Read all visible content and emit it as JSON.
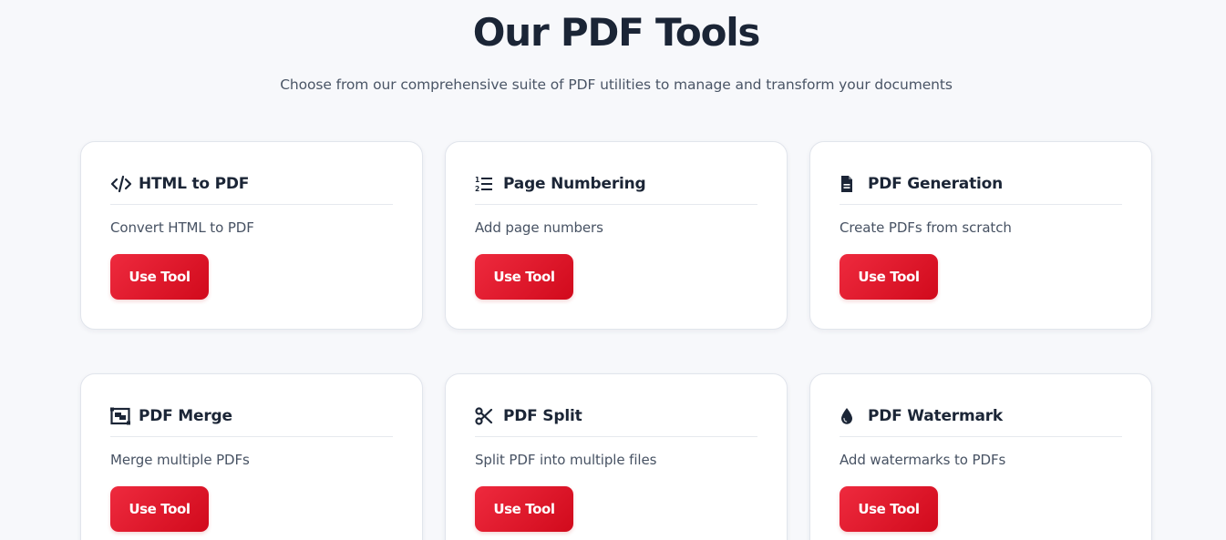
{
  "header": {
    "title": "Our PDF Tools",
    "subtitle": "Choose from our comprehensive suite of PDF utilities to manage and transform your documents"
  },
  "colors": {
    "accent": "#e01a2e",
    "background": "#f7f8fb",
    "heading": "#1b2536"
  },
  "tools": [
    {
      "icon": "code-icon",
      "title": "HTML to PDF",
      "description": "Convert HTML to PDF",
      "button": "Use Tool"
    },
    {
      "icon": "numbered-list-icon",
      "title": "Page Numbering",
      "description": "Add page numbers",
      "button": "Use Tool"
    },
    {
      "icon": "file-icon",
      "title": "PDF Generation",
      "description": "Create PDFs from scratch",
      "button": "Use Tool"
    },
    {
      "icon": "merge-icon",
      "title": "PDF Merge",
      "description": "Merge multiple PDFs",
      "button": "Use Tool"
    },
    {
      "icon": "scissors-icon",
      "title": "PDF Split",
      "description": "Split PDF into multiple files",
      "button": "Use Tool"
    },
    {
      "icon": "droplet-icon",
      "title": "PDF Watermark",
      "description": "Add watermarks to PDFs",
      "button": "Use Tool"
    }
  ]
}
